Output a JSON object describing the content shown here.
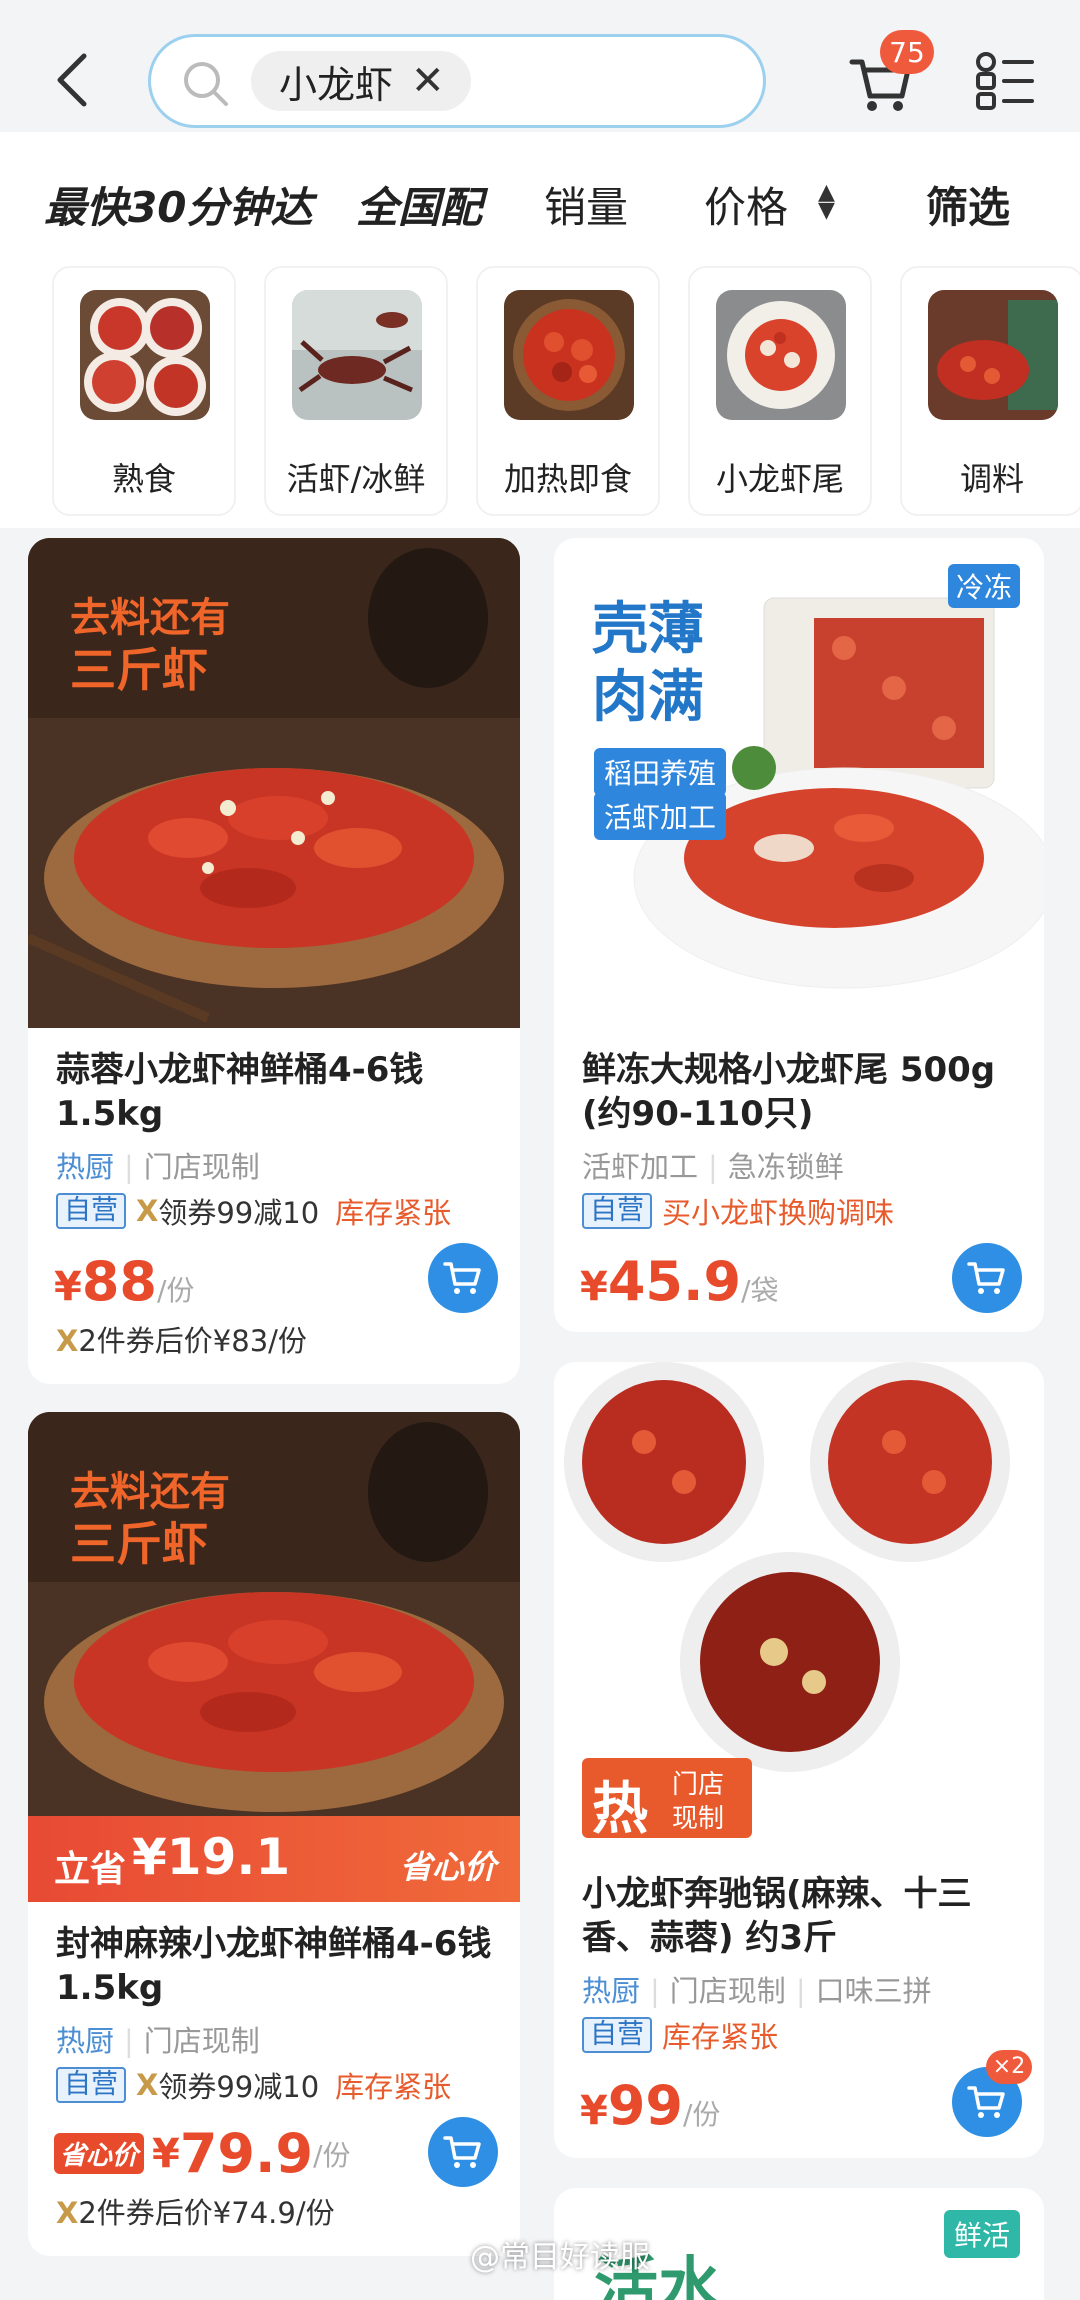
{
  "search": {
    "query": "小龙虾",
    "clear": "✕"
  },
  "header": {
    "cart_count": "75"
  },
  "filters": {
    "fast": "最快30分钟达",
    "national": "全国配",
    "sales": "销量",
    "price": "价格",
    "filter": "筛选"
  },
  "categories": [
    {
      "label": "熟食",
      "icon": "cooked-crayfish"
    },
    {
      "label": "活虾/冰鲜",
      "icon": "live-crayfish"
    },
    {
      "label": "加热即食",
      "icon": "ready-to-eat"
    },
    {
      "label": "小龙虾尾",
      "icon": "crayfish-tail"
    },
    {
      "label": "调料",
      "icon": "seasoning"
    }
  ],
  "products": [
    {
      "image_text": [
        "去料还有",
        "三斤虾"
      ],
      "title": "蒜蓉小龙虾神鲜桶4-6钱1.5kg",
      "tag1": "热厨",
      "tag2": "门店现制",
      "ziying": "自营",
      "coupon": "领券99减10",
      "warn": "库存紧张",
      "yen": "¥",
      "price": "88",
      "unit": "/份",
      "after": "2件券后价¥83/份"
    },
    {
      "image_text": [
        "壳薄",
        "肉满"
      ],
      "badge": "冷冻",
      "label1": "稻田养殖",
      "label2": "活虾加工",
      "title": "鲜冻大规格小龙虾尾 500g (约90-110只)",
      "tag1": "活虾加工",
      "tag2": "急冻锁鲜",
      "ziying": "自营",
      "promo": "买小龙虾换购调味",
      "yen": "¥",
      "price": "45.9",
      "unit": "/袋"
    },
    {
      "image_text": [
        "去料还有",
        "三斤虾"
      ],
      "save_label": "立省",
      "save_amount": "¥19.1",
      "heart_price": "省心价",
      "title": "封神麻辣小龙虾神鲜桶4-6钱1.5kg",
      "tag1": "热厨",
      "tag2": "门店现制",
      "ziying": "自营",
      "coupon": "领券99减10",
      "warn": "库存紧张",
      "yen": "¥",
      "price": "79.9",
      "unit": "/份",
      "after": "2件券后价¥74.9/份"
    },
    {
      "hot": "热",
      "hot_sub1": "门店",
      "hot_sub2": "现制",
      "title": "小龙虾奔驰锅(麻辣、十三香、蒜蓉) 约3斤",
      "tag1": "热厨",
      "tag2": "门店现制",
      "tag3": "口味三拼",
      "ziying": "自营",
      "warn": "库存紧张",
      "yen": "¥",
      "price": "99",
      "unit": "/份",
      "cart_qty": "×2"
    },
    {
      "badge": "鲜活",
      "image_text": "活水"
    }
  ],
  "watermark": "@常目好读服",
  "colors": {
    "accent": "#2e8fe4",
    "price": "#e84b2b",
    "badge": "#ef5a3c"
  }
}
